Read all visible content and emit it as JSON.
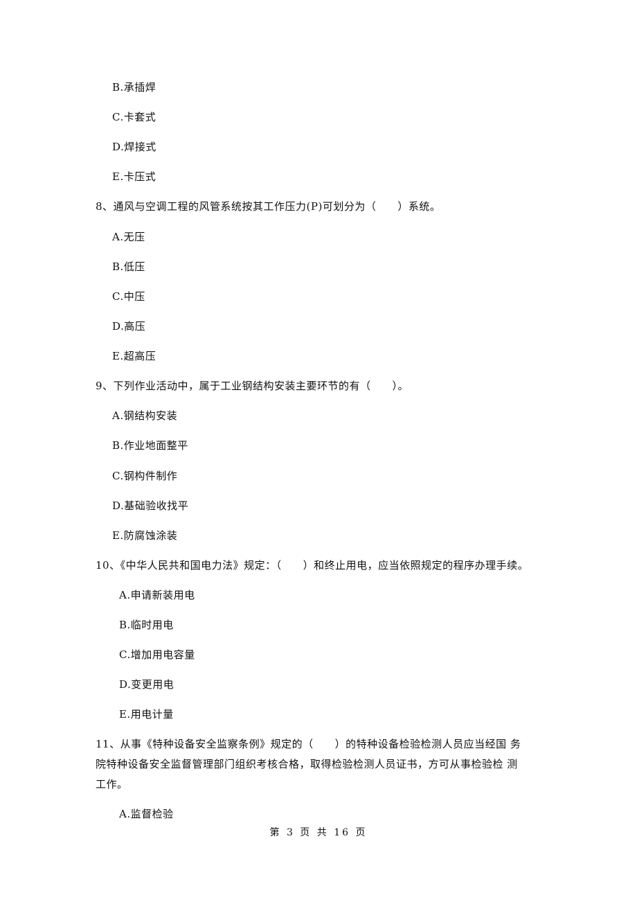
{
  "page": {
    "q7_options": [
      "B.承插焊",
      "C.卡套式",
      "D.焊接式",
      "E.卡压式"
    ],
    "q8": {
      "stem": "8、通风与空调工程的风管系统按其工作压力(P)可划分为（　　）系统。",
      "options": [
        "A.无压",
        "B.低压",
        "C.中压",
        "D.高压",
        "E.超高压"
      ]
    },
    "q9": {
      "stem": "9、下列作业活动中，属于工业钢结构安装主要环节的有（　　）。",
      "options": [
        "A.钢结构安装",
        "B.作业地面整平",
        "C.钢构件制作",
        "D.基础验收找平",
        "E.防腐蚀涂装"
      ]
    },
    "q10": {
      "stem": "10、《中华人民共和国电力法》规定：（　　）和终止用电，应当依照规定的程序办理手续。",
      "options": [
        "A.申请新装用电",
        "B.临时用电",
        "C.增加用电容量",
        "D.变更用电",
        "E.用电计量"
      ]
    },
    "q11": {
      "stem_lines": [
        "11、从事《特种设备安全监察条例》规定的（　　）的特种设备检验检测人员应当经国 务",
        "院特种设备安全监督管理部门组织考核合格，取得检验检测人员证书，方可从事检验检 测",
        "工作。"
      ],
      "options": [
        "A.监督检验"
      ]
    },
    "footer": "第 3 页 共 16 页"
  }
}
